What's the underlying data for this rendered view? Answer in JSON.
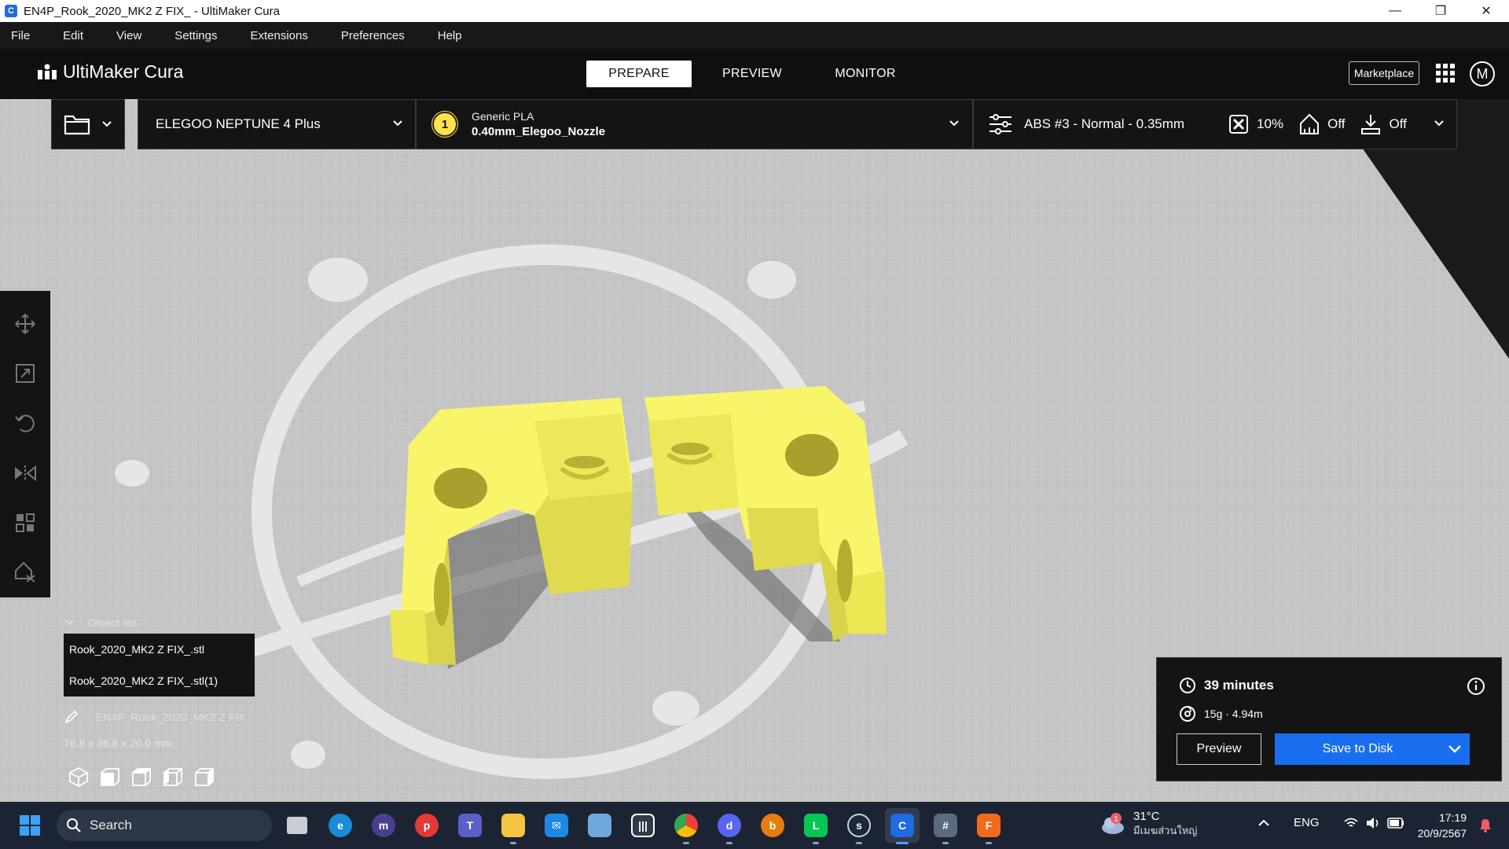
{
  "window": {
    "title": "EN4P_Rook_2020_MK2 Z FIX_ - UltiMaker Cura",
    "minimize": "—",
    "maximize": "❐",
    "close": "✕"
  },
  "menu": [
    "File",
    "Edit",
    "View",
    "Settings",
    "Extensions",
    "Preferences",
    "Help"
  ],
  "header": {
    "app_name": "UltiMaker Cura",
    "stages": [
      "PREPARE",
      "PREVIEW",
      "MONITOR"
    ],
    "active_stage": "PREPARE",
    "marketplace": "Marketplace",
    "account_initial": "M"
  },
  "toolbar": {
    "printer": "ELEGOO NEPTUNE 4 Plus",
    "extruder_number": "1",
    "material_type": "Generic PLA",
    "nozzle": "0.40mm_Elegoo_Nozzle",
    "profile": "ABS #3 - Normal - 0.35mm",
    "infill": "10%",
    "support": "Off",
    "adhesion": "Off"
  },
  "object_list": {
    "header": "Object list",
    "items": [
      "Rook_2020_MK2 Z FIX_.stl",
      "Rook_2020_MK2 Z FIX_.stl(1)"
    ],
    "job_name": "EN4P_Rook_2020_MK2 Z FIX_",
    "dimensions": "76.8 x 36.8 x 20.0 mm"
  },
  "print_panel": {
    "time": "39 minutes",
    "material": "15g · 4.94m",
    "preview_label": "Preview",
    "save_label": "Save to Disk"
  },
  "taskbar": {
    "search_placeholder": "Search",
    "weather_temp": "31°C",
    "weather_location": "มีเมฆส่วนใหญ่",
    "weather_badge": "1",
    "language": "ENG",
    "time": "17:19",
    "date": "20/9/2567"
  },
  "colors": {
    "accent_blue": "#196ef0",
    "model_yellow": "#f9f56a",
    "build_plate": "#c4c4c4"
  }
}
